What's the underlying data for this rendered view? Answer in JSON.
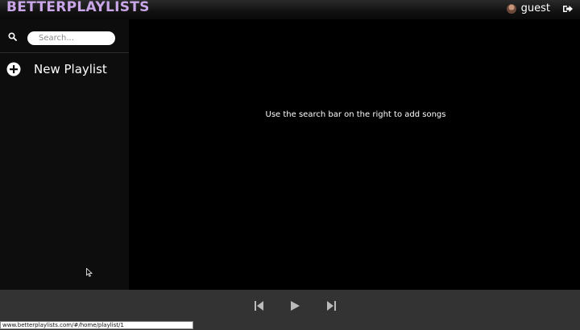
{
  "app": {
    "logo": "BETTERPLAYLISTS"
  },
  "user": {
    "name": "guest"
  },
  "icons": {
    "avatar": "avatar-icon",
    "logout": "logout-icon",
    "search": "search-icon",
    "add": "plus-circle-icon",
    "previous": "skip-back-icon",
    "play": "play-icon",
    "next": "skip-forward-icon"
  },
  "sidebar": {
    "search": {
      "placeholder": "Search..."
    },
    "new_playlist_label": "New Playlist"
  },
  "main": {
    "empty_hint": "Use the search bar on the right to add songs"
  },
  "status_bar": {
    "url": "www.betterplaylists.com/#/home/playlist/1"
  },
  "colors": {
    "logo": "#c9a6e8",
    "player_bar": "#333333",
    "sidebar": "#0d0d0d"
  }
}
